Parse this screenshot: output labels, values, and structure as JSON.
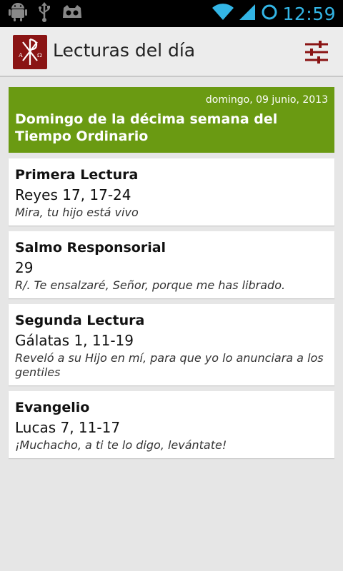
{
  "status_bar": {
    "time": "12:59",
    "left_icons": [
      "android-icon",
      "usb-icon",
      "gamepad-icon"
    ],
    "right_icons": [
      "wifi-icon",
      "signal-icon",
      "battery-icon"
    ],
    "accent_color": "#33b5e5"
  },
  "action_bar": {
    "title": "Lecturas del día",
    "logo_icon": "chi-rho-logo-icon",
    "settings_icon": "sliders-icon",
    "brand_color": "#8a1414"
  },
  "header": {
    "date": "domingo, 09 junio, 2013",
    "title": "Domingo de la décima semana del Tiempo Ordinario",
    "color": "#6a9a12"
  },
  "readings": [
    {
      "title": "Primera Lectura",
      "reference": "Reyes 17, 17-24",
      "quote": "Mira, tu hijo está vivo"
    },
    {
      "title": "Salmo Responsorial",
      "reference": "29",
      "quote": "R/. Te ensalzaré, Señor, porque me has librado."
    },
    {
      "title": "Segunda Lectura",
      "reference": "Gálatas 1, 11-19",
      "quote": "Reveló a su Hijo en mí, para que yo lo anunciara a los gentiles"
    },
    {
      "title": "Evangelio",
      "reference": "Lucas 7, 11-17",
      "quote": "¡Muchacho, a ti te lo digo, levántate!"
    }
  ]
}
